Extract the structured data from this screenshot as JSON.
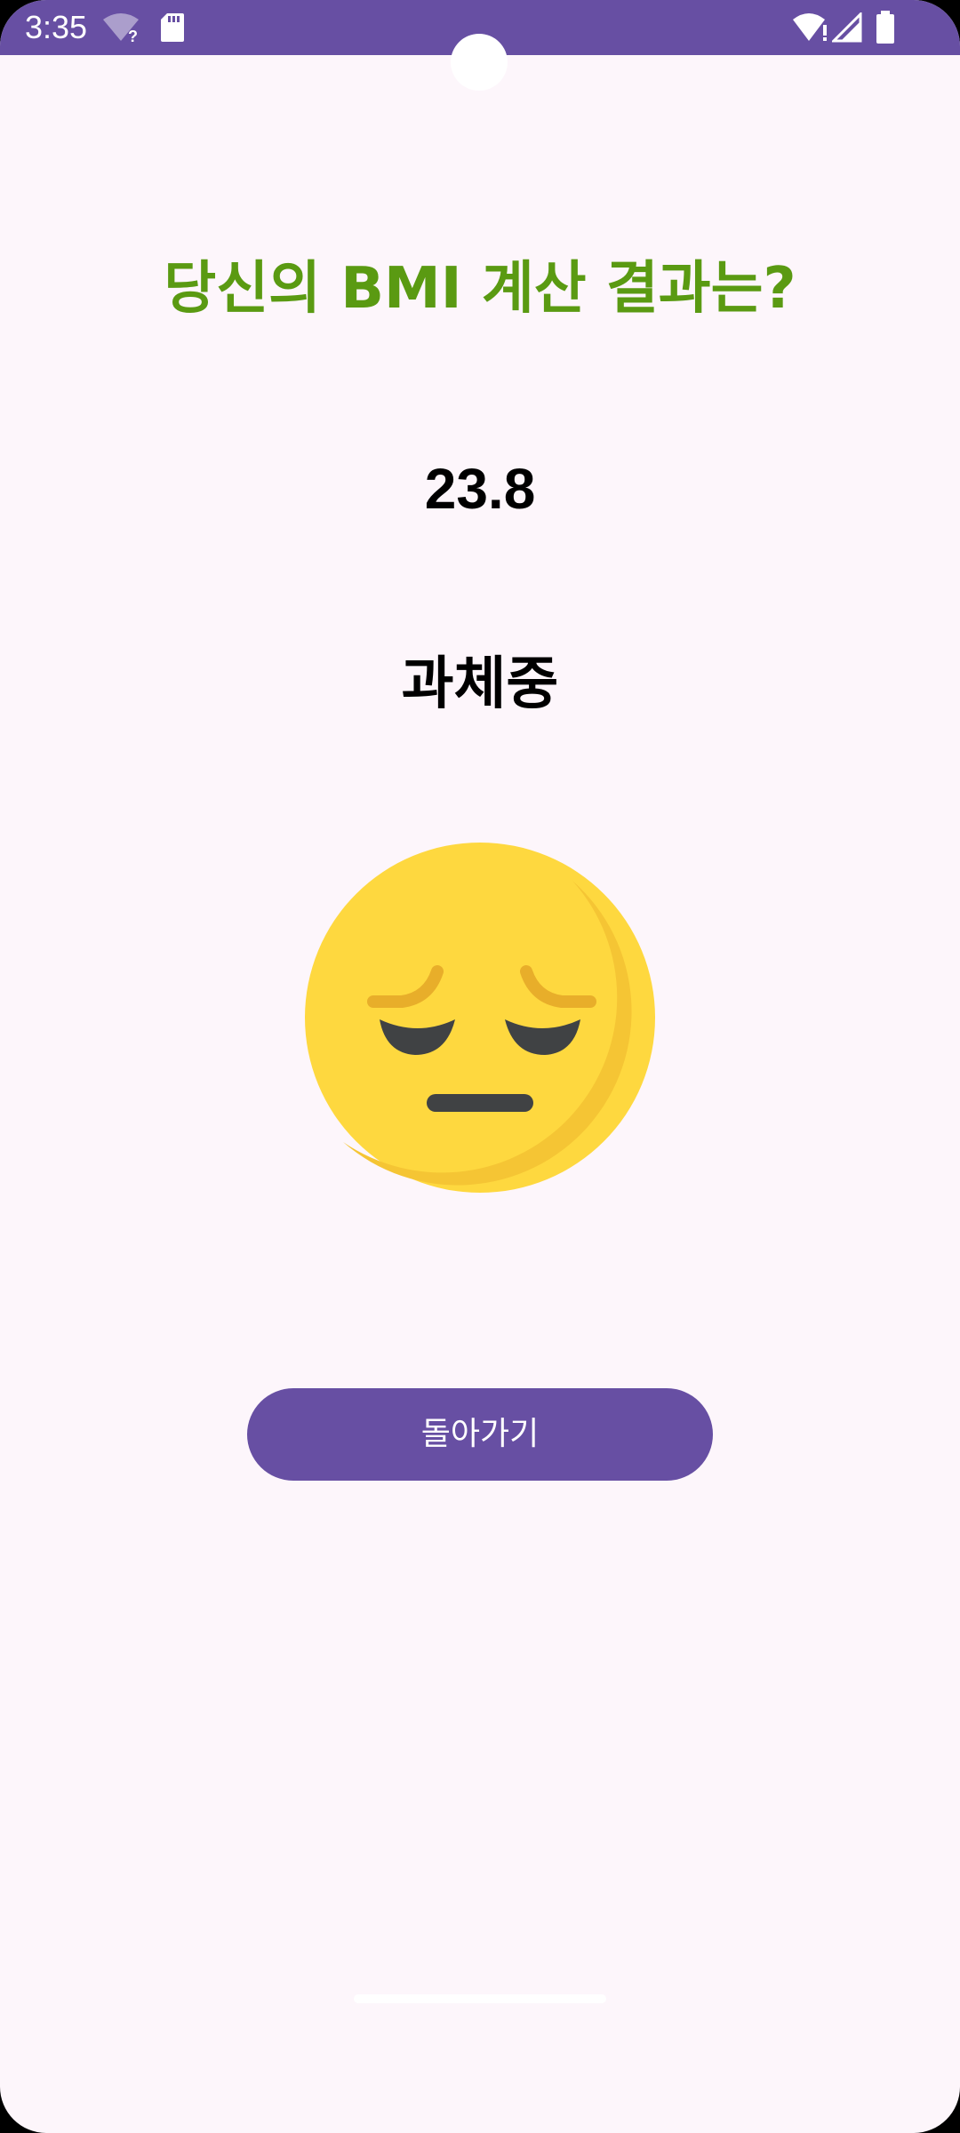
{
  "status_bar": {
    "time": "3:35",
    "icons": [
      "wifi-unknown-icon",
      "sd-card-icon",
      "wifi-icon",
      "signal-icon",
      "battery-icon"
    ]
  },
  "result": {
    "title": "당신의 BMI 계산 결과는?",
    "bmi_value": "23.8",
    "status": "과체중",
    "emoji": "pensive-face-icon"
  },
  "actions": {
    "back_label": "돌아가기"
  },
  "colors": {
    "accent": "#674fa3",
    "title_green": "#5a9a12",
    "background": "#fdf6fb"
  }
}
